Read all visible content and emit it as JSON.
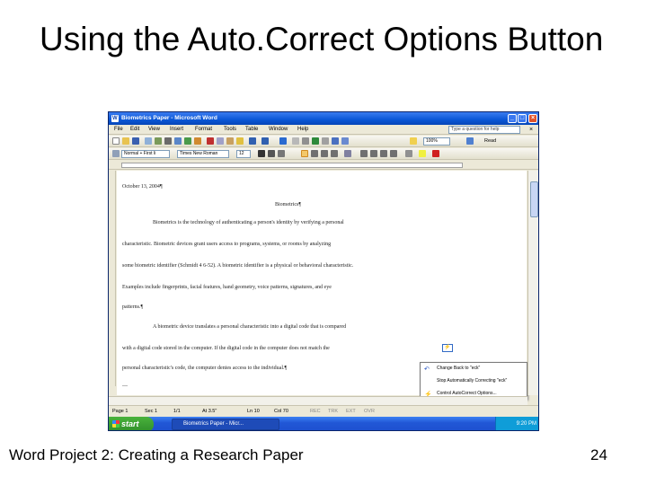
{
  "slide": {
    "title": "Using the Auto.Correct Options Button",
    "footer": "Word Project 2: Creating a Research Paper",
    "page_number": "24"
  },
  "window": {
    "title": "Biometrics Paper - Microsoft Word",
    "menu": [
      "File",
      "Edit",
      "View",
      "Insert",
      "Format",
      "Tools",
      "Table",
      "Window",
      "Help"
    ],
    "help_placeholder": "Type a question for help",
    "zoom": "100%",
    "read_label": "Read",
    "style": "Normal + First li",
    "font": "Times New Roman",
    "font_size": "12"
  },
  "document": {
    "lines": [
      "October 13, 2004¶",
      "Biometrics¶",
      "Biometrics is the technology of authenticating a person's identity by verifying a personal",
      "characteristic. Biometric devices grant users access to programs, systems, or rooms by analyzing",
      "some biometric identifier (Schmidt 4 6-52). A biometric identifier is a physical or behavioral characteristic.",
      "Examples include fingerprints, facial features, hand geometry, voice patterns, signatures, and eye",
      "patterns.¶",
      "A biometric device translates a personal characteristic into a digital code that is compared",
      "with a digital code stored in the computer. If the digital code in the computer does not match the",
      "personal characteristic's code, the computer denies access to the individual.¶",
      "—"
    ]
  },
  "autocorrect_menu": {
    "items": [
      "Change Back to \"eck\"",
      "Stop Automatically Correcting \"eck\"",
      "Control AutoCorrect Options..."
    ]
  },
  "status": {
    "page": "Page 1",
    "sec": "Sec 1",
    "pages": "1/1",
    "at": "At 3.5\"",
    "ln": "Ln 10",
    "col": "Col 70",
    "rec": "REC",
    "trk": "TRK",
    "ext": "EXT",
    "ovr": "OVR"
  },
  "taskbar": {
    "start": "start",
    "task": "Biometrics Paper - Micr...",
    "clock": "9:20 PM"
  }
}
